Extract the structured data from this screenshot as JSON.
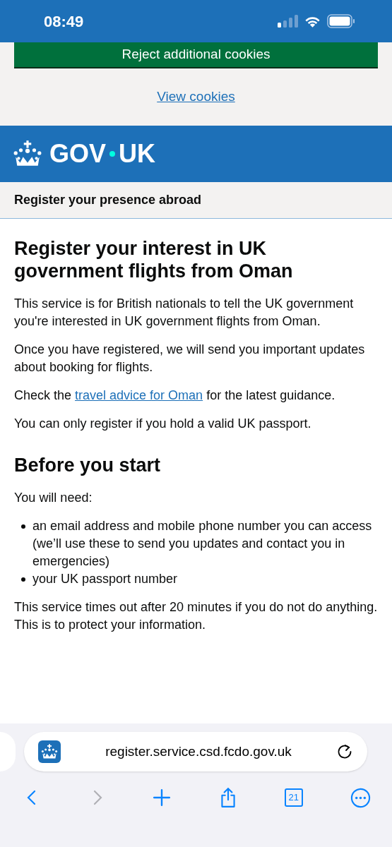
{
  "status_bar": {
    "time": "08:49"
  },
  "cookie_banner": {
    "reject_button": "Reject additional cookies",
    "view_link": "View cookies"
  },
  "header": {
    "logo_parts": [
      "GOV",
      "UK"
    ]
  },
  "service_name": "Register your presence abroad",
  "content": {
    "title": "Register your interest in UK government flights from Oman",
    "paragraphs": [
      {
        "text": "This service is for British nationals to tell the UK government you're interested in UK government flights from Oman."
      },
      {
        "text": "Once you have registered, we will send you important updates about booking for flights."
      },
      {
        "before": "Check the ",
        "link": "travel advice for Oman",
        "after": " for the latest guidance."
      },
      {
        "text": "You can only register if you hold a valid UK passport."
      }
    ],
    "section_title": "Before you start",
    "intro": "You will need:",
    "list": [
      "an email address and mobile phone number you can access (we’ll use these to send you updates and contact you in emergencies)",
      "your UK passport number"
    ],
    "note": "This service times out after 20 minutes if you do not do anything. This is to protect your information."
  },
  "browser": {
    "url": "register.service.csd.fcdo.gov.uk",
    "tab_count": "21",
    "back_disabled": false,
    "forward_disabled": true
  }
}
